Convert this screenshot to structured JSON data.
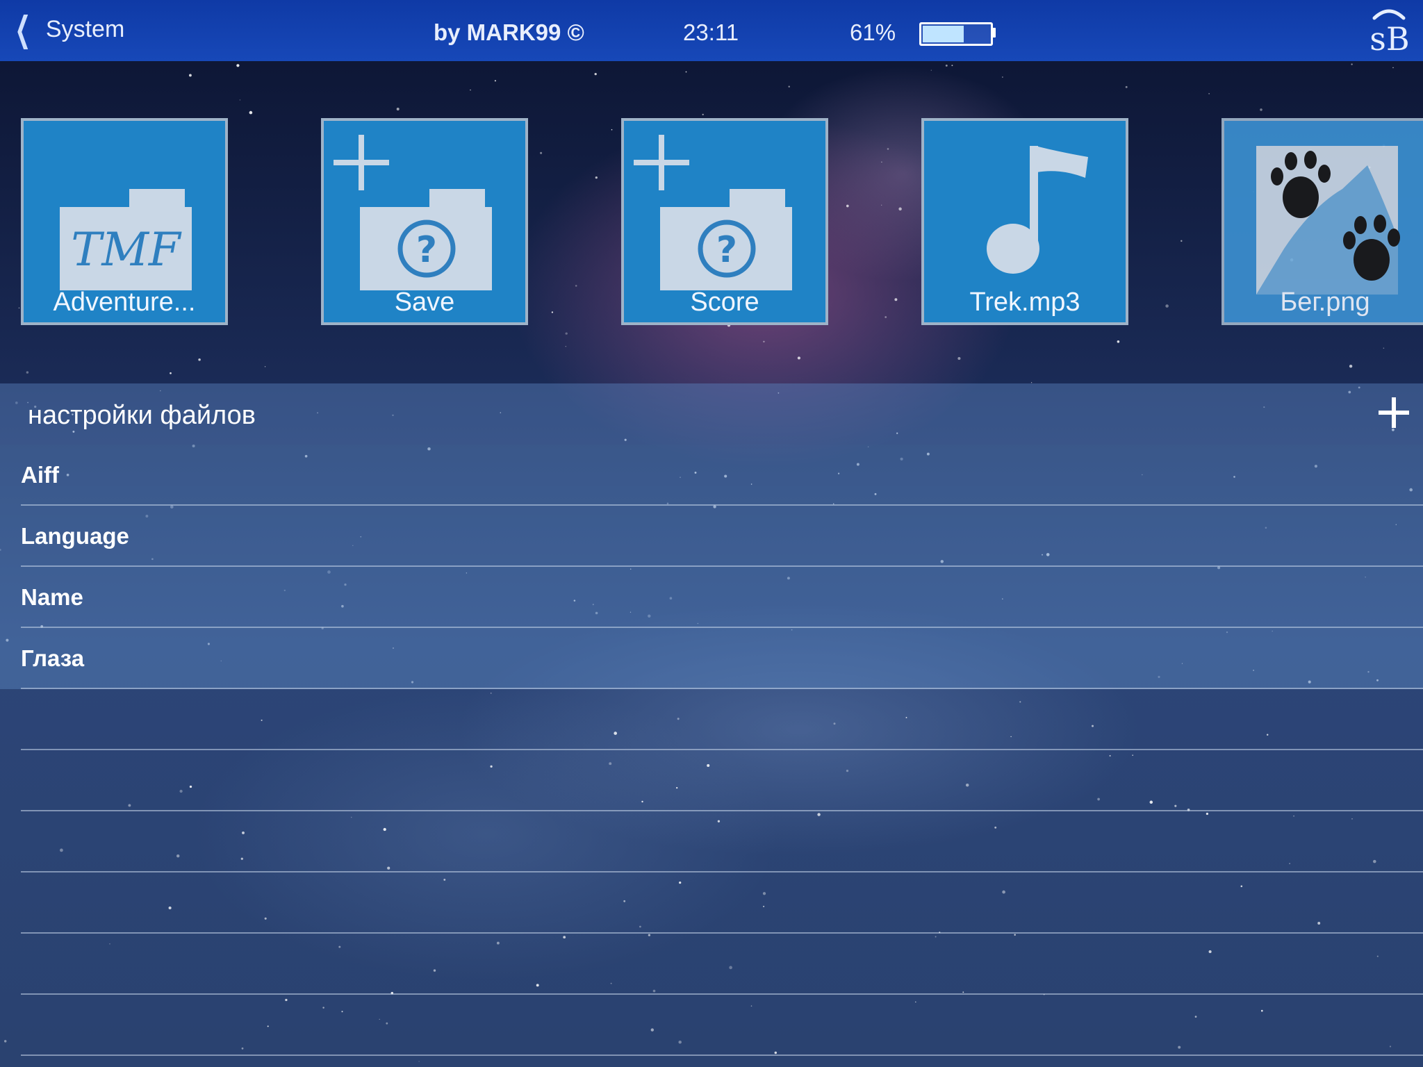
{
  "topbar": {
    "back_label": "System",
    "author": "by MARK99 ©",
    "time": "23:11",
    "battery_text": "61%",
    "battery_level": 0.61,
    "logo_text": "sB"
  },
  "tiles": [
    {
      "label": "Adventure...",
      "icon": "tmf-folder-icon",
      "tmf_text": "TMF"
    },
    {
      "label": "Save",
      "icon": "new-folder-unknown-icon"
    },
    {
      "label": "Score",
      "icon": "new-folder-unknown-icon"
    },
    {
      "label": "Trek.mp3",
      "icon": "music-note-icon"
    },
    {
      "label": "Бег.png",
      "icon": "paw-image-icon"
    }
  ],
  "settings": {
    "title": "настройки файлов",
    "items": [
      "Aiff",
      "Language",
      "Name",
      "Глаза"
    ]
  },
  "colors": {
    "topbar": "#1748b8",
    "tile": "#1f83c6",
    "tile_border": "#9fb3c8",
    "icon_fill": "#c9d7e6"
  }
}
